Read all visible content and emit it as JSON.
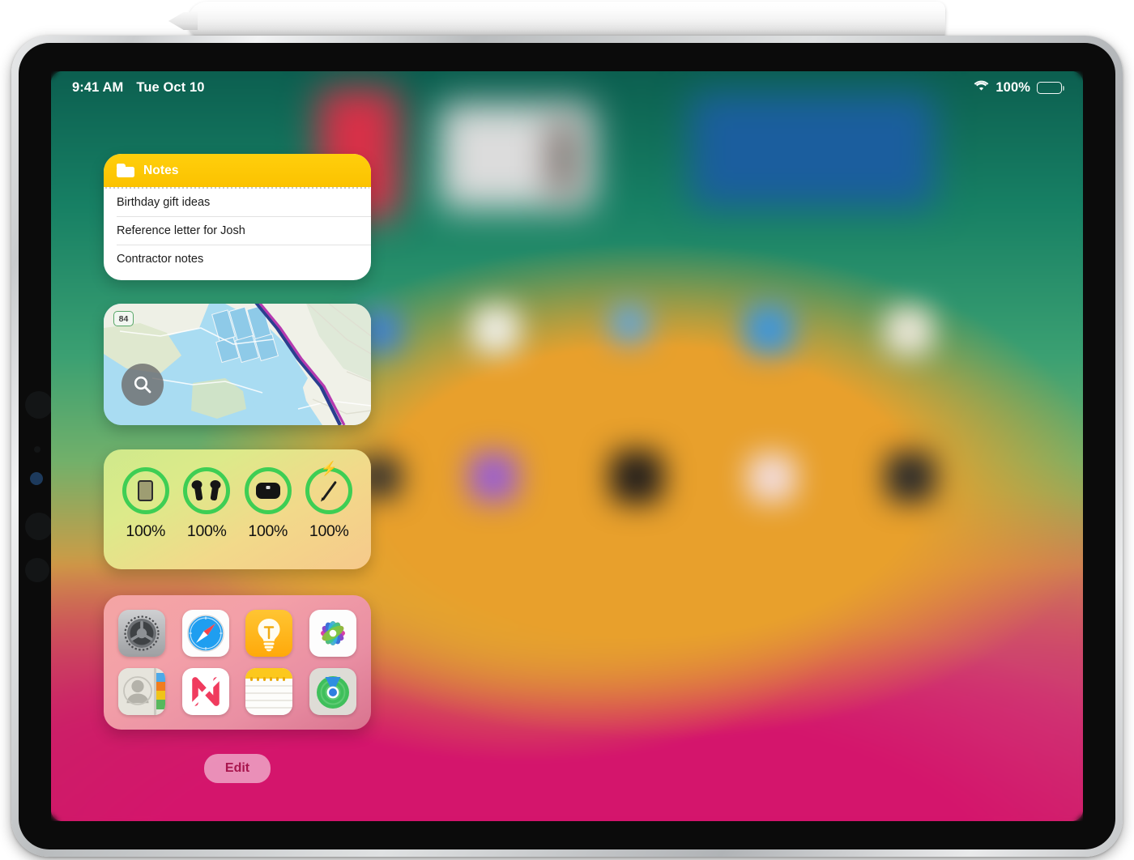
{
  "device": {
    "name": "iPad",
    "accessory": "apple-pencil",
    "frame_color": "#cfd1d3",
    "bezel_color": "#0b0b0b"
  },
  "status_bar": {
    "time": "9:41 AM",
    "date": "Tue Oct 10",
    "wifi_icon": "wifi-icon",
    "battery_percent": "100%",
    "battery_level": 100
  },
  "wallpaper": {
    "description": "blurred home screen",
    "colors": [
      "#0c5f50",
      "#3ba072",
      "#e8a02c",
      "#d9bb2f",
      "#c71f63"
    ]
  },
  "widgets": [
    {
      "id": "notes",
      "name": "Notes",
      "title": "Notes",
      "header_color": "#fbc200",
      "icon": "folder-icon",
      "items": [
        "Birthday gift ideas",
        "Reference letter for Josh",
        "Contractor notes"
      ]
    },
    {
      "id": "maps",
      "name": "Maps",
      "route_badge": "84",
      "search_icon": "search-icon"
    },
    {
      "id": "batteries",
      "name": "Batteries",
      "devices": [
        {
          "device": "iPad",
          "icon": "ipad-icon",
          "percent": "100%",
          "charging": false
        },
        {
          "device": "AirPods",
          "icon": "airpods-icon",
          "percent": "100%",
          "charging": false
        },
        {
          "device": "AirPods Case",
          "icon": "airpods-case-icon",
          "percent": "100%",
          "charging": false
        },
        {
          "device": "Apple Pencil",
          "icon": "apple-pencil-icon",
          "percent": "100%",
          "charging": true
        }
      ],
      "ring_color": "#3ece54"
    },
    {
      "id": "app-suggestions",
      "name": "App Suggestions",
      "apps": [
        {
          "name": "Settings",
          "icon": "settings-icon"
        },
        {
          "name": "Safari",
          "icon": "safari-icon"
        },
        {
          "name": "Tips",
          "icon": "tips-icon"
        },
        {
          "name": "Photos",
          "icon": "photos-icon"
        },
        {
          "name": "Contacts",
          "icon": "contacts-icon"
        },
        {
          "name": "News",
          "icon": "news-icon"
        },
        {
          "name": "Notes",
          "icon": "notes-icon"
        },
        {
          "name": "Find My",
          "icon": "findmy-icon"
        }
      ]
    }
  ],
  "edit_button": {
    "label": "Edit",
    "text_color": "#a8154d"
  }
}
